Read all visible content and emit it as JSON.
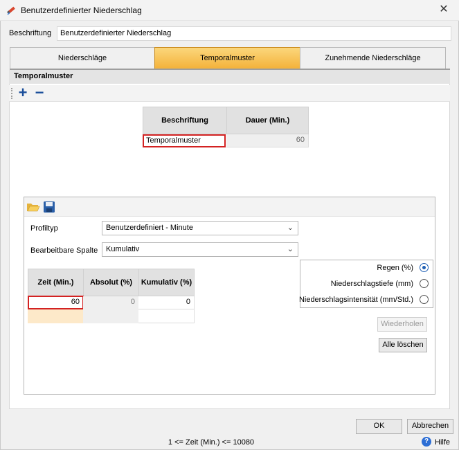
{
  "window": {
    "title": "Benutzerdefinierter Niederschlag",
    "close_glyph": "✕"
  },
  "caption": {
    "label": "Beschriftung",
    "value": "Benutzerdefinierter Niederschlag"
  },
  "tabs": [
    {
      "label": "Niederschläge",
      "active": false
    },
    {
      "label": "Temporalmuster",
      "active": true
    },
    {
      "label": "Zunehmende Niederschläge",
      "active": false
    }
  ],
  "section": {
    "title": "Temporalmuster",
    "add_glyph": "+",
    "remove_glyph": "−"
  },
  "pattern_grid": {
    "headers": [
      "Beschriftung",
      "Dauer (Min.)"
    ],
    "rows": [
      {
        "label": "Temporalmuster",
        "duration": "60"
      }
    ]
  },
  "profile": {
    "type_label": "Profiltyp",
    "type_value": "Benutzerdefiniert - Minute",
    "column_label": "Bearbeitbare Spalte",
    "column_value": "Kumulativ"
  },
  "values_grid": {
    "headers": [
      "Zeit (Min.)",
      "Absolut (%)",
      "Kumulativ (%)"
    ],
    "rows": [
      [
        "60",
        "0",
        "0"
      ],
      [
        "",
        "",
        ""
      ]
    ]
  },
  "radio_options": [
    {
      "label": "Regen (%)",
      "selected": true
    },
    {
      "label": "Niederschlagstiefe (mm)",
      "selected": false
    },
    {
      "label": "Niederschlagsintensität (mm/Std.)",
      "selected": false
    }
  ],
  "buttons": {
    "repeat": "Wiederholen",
    "clear_all": "Alle löschen",
    "ok": "OK",
    "cancel": "Abbrechen"
  },
  "status": {
    "text": "1 <= Zeit (Min.) <= 10080",
    "help": "Hilfe",
    "help_glyph": "?"
  },
  "colors": {
    "accent": "#f4b23a",
    "error_border": "#d32222",
    "radio": "#1e5fb4"
  },
  "icons": [
    "pencil-rain-icon",
    "close-icon",
    "add-icon",
    "remove-icon",
    "folder-open-icon",
    "save-icon",
    "chevron-down-icon",
    "help-icon"
  ]
}
